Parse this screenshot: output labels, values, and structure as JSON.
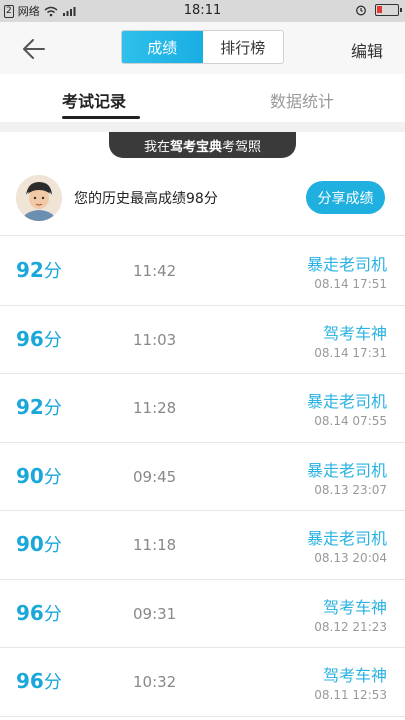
{
  "status_bar": {
    "sim": "2",
    "carrier": "网络",
    "time": "18:11",
    "battery_level": 0.25
  },
  "nav": {
    "back_icon": "arrow-left-icon",
    "tab_score": "成绩",
    "tab_ranking": "排行榜",
    "edit_label": "编辑"
  },
  "subtabs": {
    "records": "考试记录",
    "stats": "数据统计"
  },
  "banner": {
    "prefix": "我在",
    "brand": "驾考宝典",
    "suffix": "考驾照"
  },
  "profile": {
    "best_score_text": "您的历史最高成绩98分",
    "share_label": "分享成绩"
  },
  "records": [
    {
      "score": "92",
      "unit": "分",
      "duration": "11:42",
      "title": "暴走老司机",
      "datetime": "08.14  17:51"
    },
    {
      "score": "96",
      "unit": "分",
      "duration": "11:03",
      "title": "驾考车神",
      "datetime": "08.14  17:31"
    },
    {
      "score": "92",
      "unit": "分",
      "duration": "11:28",
      "title": "暴走老司机",
      "datetime": "08.14  07:55"
    },
    {
      "score": "90",
      "unit": "分",
      "duration": "09:45",
      "title": "暴走老司机",
      "datetime": "08.13  23:07"
    },
    {
      "score": "90",
      "unit": "分",
      "duration": "11:18",
      "title": "暴走老司机",
      "datetime": "08.13  20:04"
    },
    {
      "score": "96",
      "unit": "分",
      "duration": "09:31",
      "title": "驾考车神",
      "datetime": "08.12  21:23"
    },
    {
      "score": "96",
      "unit": "分",
      "duration": "10:32",
      "title": "驾考车神",
      "datetime": "08.11  12:53"
    }
  ],
  "colors": {
    "accent": "#1fb0e0",
    "score": "#1aa7da"
  }
}
